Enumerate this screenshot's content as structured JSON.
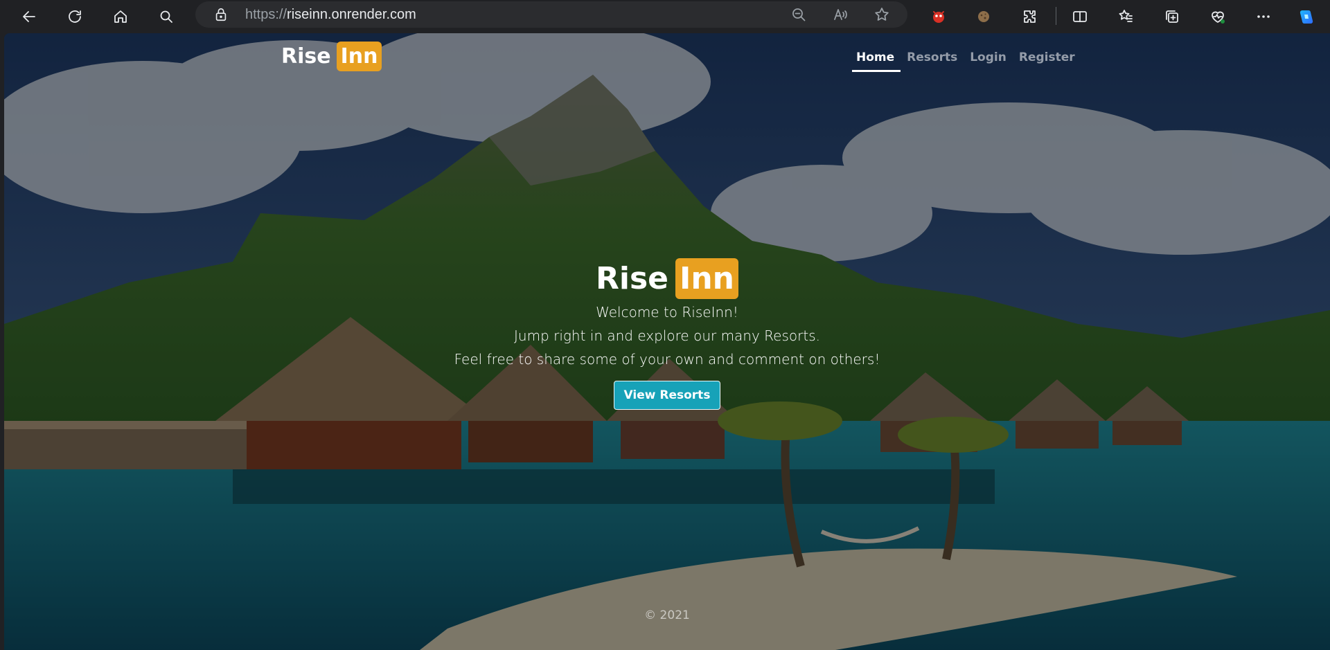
{
  "browser": {
    "url_scheme": "https://",
    "url_host": "riseinn.onrender.com",
    "back_icon": "back-arrow-icon",
    "refresh_icon": "refresh-icon",
    "home_icon": "home-icon",
    "search_icon": "search-icon",
    "lock_icon": "lock-icon",
    "toolbar_icons": [
      "zoom-out-icon",
      "read-aloud-icon",
      "favorite-star-icon",
      "extension-icon",
      "cookie-extension-icon",
      "extensions-puzzle-icon",
      "split-screen-icon",
      "favorites-list-icon",
      "collections-icon",
      "browser-essentials-icon",
      "more-menu-icon",
      "copilot-icon"
    ]
  },
  "site": {
    "logo_text": "Rise",
    "logo_badge": "Inn",
    "nav": [
      {
        "label": "Home",
        "active": true
      },
      {
        "label": "Resorts",
        "active": false
      },
      {
        "label": "Login",
        "active": false
      },
      {
        "label": "Register",
        "active": false
      }
    ]
  },
  "hero": {
    "title": "Rise",
    "title_badge": "Inn",
    "line1": "Welcome to RiseInn!",
    "line2": "Jump right in and explore our many Resorts.",
    "line3": "Feel free to share some of your own and comment on others!",
    "cta_label": "View Resorts"
  },
  "footer": {
    "copyright": "© 2021"
  },
  "colors": {
    "accent": "#e8a020",
    "cta": "#17a2b8"
  }
}
